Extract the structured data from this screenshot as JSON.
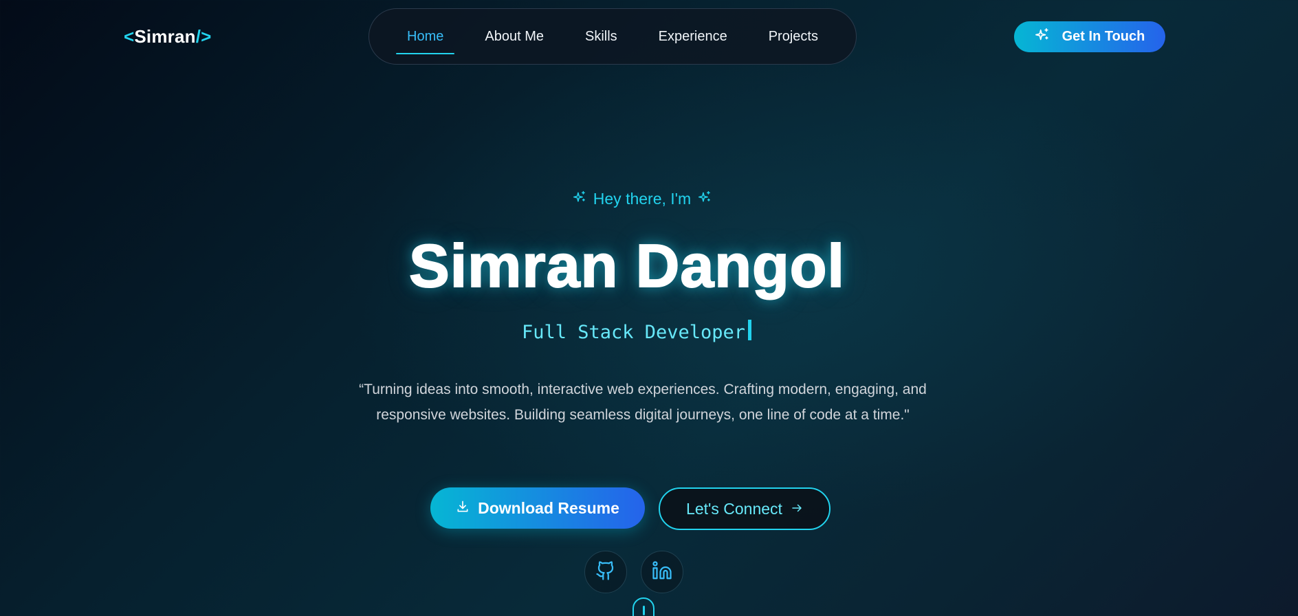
{
  "header": {
    "logo": {
      "open": "<",
      "name": "Simran",
      "close": "/>"
    },
    "nav": [
      {
        "label": "Home",
        "active": true
      },
      {
        "label": "About Me",
        "active": false
      },
      {
        "label": "Skills",
        "active": false
      },
      {
        "label": "Experience",
        "active": false
      },
      {
        "label": "Projects",
        "active": false
      }
    ],
    "cta_label": "Get In Touch",
    "cta_icon": "sparkles-icon"
  },
  "hero": {
    "greeting": "Hey there, I'm",
    "greeting_icon": "sparkles-icon",
    "name": "Simran Dangol",
    "role": "Full Stack Developer",
    "quote": "“Turning ideas into smooth, interactive web experiences. Crafting modern, engaging, and responsive websites. Building seamless digital journeys, one line of code at a time.\"",
    "primary_button": {
      "label": "Download Resume",
      "icon": "download-icon"
    },
    "secondary_button": {
      "label": "Let's Connect",
      "icon": "arrow-right-icon"
    },
    "socials": [
      {
        "name": "github",
        "icon": "github-icon"
      },
      {
        "name": "linkedin",
        "icon": "linkedin-icon"
      }
    ],
    "scroll_indicator": "mouse-icon"
  },
  "colors": {
    "accent": "#22d3ee",
    "gradient_start": "#06b6d4",
    "gradient_end": "#2563eb",
    "background": "#06202e"
  }
}
